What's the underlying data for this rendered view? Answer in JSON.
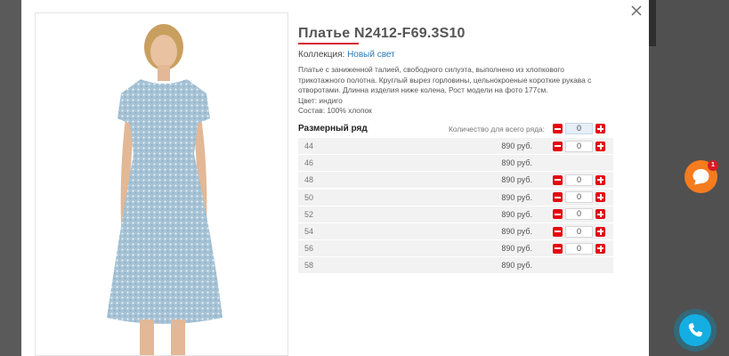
{
  "product": {
    "title": "Платье N2412-F69.3S10",
    "collection_label": "Коллекция:",
    "collection_link": "Новый свет",
    "description": "Платье с заниженной талией, свободного силуэта, выполнено из хлопкового трикотажного полотна. Круглый вырез горловины, цельнокроеные короткие рукава с отворотами. Длинна изделия ниже колена. Рост модели на фото 177см.",
    "color_line": "Цвет: индиго",
    "composition_line": "Состав: 100% хлопок",
    "photo_icon": "dress-photo"
  },
  "sizes": {
    "title": "Размерный ряд",
    "qty_all_label": "Количество для всего ряда:",
    "qty_all_value": "0",
    "rows": [
      {
        "size": "44",
        "price": "890 руб.",
        "has_qty": true,
        "qty": "0"
      },
      {
        "size": "46",
        "price": "890 руб.",
        "has_qty": false,
        "qty": ""
      },
      {
        "size": "48",
        "price": "890 руб.",
        "has_qty": true,
        "qty": "0"
      },
      {
        "size": "50",
        "price": "890 руб.",
        "has_qty": true,
        "qty": "0"
      },
      {
        "size": "52",
        "price": "890 руб.",
        "has_qty": true,
        "qty": "0"
      },
      {
        "size": "54",
        "price": "890 руб.",
        "has_qty": true,
        "qty": "0"
      },
      {
        "size": "56",
        "price": "890 руб.",
        "has_qty": true,
        "qty": "0"
      },
      {
        "size": "58",
        "price": "890 руб.",
        "has_qty": false,
        "qty": ""
      }
    ]
  },
  "widgets": {
    "chat_badge_count": "1",
    "chat_icon": "chat-icon",
    "call_icon": "phone-icon",
    "close_icon": "close-icon"
  },
  "colors": {
    "accent_red": "#e30613",
    "link_blue": "#2a7ab8",
    "chat_orange": "#f57c1f",
    "call_blue": "#14aee3"
  }
}
